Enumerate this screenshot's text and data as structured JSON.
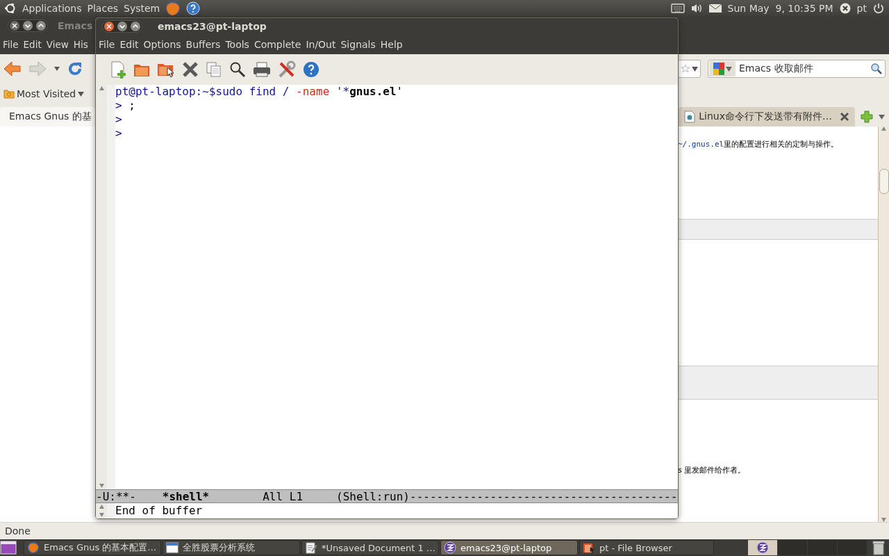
{
  "top_panel": {
    "menus": [
      "Applications",
      "Places",
      "System"
    ],
    "clock": "Sun May  9, 10:35 PM",
    "user": "pt"
  },
  "browser": {
    "title": "Emacs",
    "menus": [
      "File",
      "Edit",
      "View",
      "His"
    ],
    "search": {
      "value": "Emacs 收取邮件"
    },
    "bookmarks": [
      "Most Visited"
    ],
    "tabs": [
      {
        "label": "Emacs Gnus 的基",
        "selected": true
      },
      {
        "label": "Linux命令行下发送带有附件…",
        "selected": false
      }
    ],
    "content": [
      {
        "kind": "text",
        "code": "~/.gnus.el",
        "text": "里的配置进行相关的定制与操作。"
      },
      {
        "kind": "box"
      },
      {
        "kind": "box"
      },
      {
        "kind": "text",
        "text": "s 里发邮件给作者。"
      }
    ],
    "status": "Done"
  },
  "emacs": {
    "title": "emacs23@pt-laptop",
    "menus": [
      "File",
      "Edit",
      "Options",
      "Buffers",
      "Tools",
      "Complete",
      "In/Out",
      "Signals",
      "Help"
    ],
    "lines": [
      [
        {
          "text": "pt@pt-laptop:~$sudo find / ",
          "kind": "input"
        },
        {
          "text": "-name",
          "kind": "option"
        },
        {
          "text": " '*",
          "kind": "input"
        },
        {
          "text": "gnus.el",
          "kind": "match"
        },
        {
          "text": "'",
          "kind": "text"
        }
      ],
      [
        {
          "text": "> ",
          "kind": "input"
        },
        {
          "text": ";",
          "kind": "text"
        }
      ],
      [
        {
          "text": ">",
          "kind": "input"
        }
      ],
      [
        {
          "text": ">",
          "kind": "input"
        }
      ]
    ],
    "modeline": [
      {
        "text": "-U:**-",
        "bold": false
      },
      {
        "text": "*shell*",
        "bold": true
      },
      {
        "text": "All L1",
        "bold": false
      },
      {
        "text": "(Shell:run)----------------------------------------",
        "bold": false
      }
    ],
    "minibuffer": "End of buffer"
  },
  "taskbar": [
    {
      "label": "Emacs Gnus 的基本配置…",
      "kind": "browser",
      "selected": false
    },
    {
      "label": "全胜股票分析系统",
      "kind": "window",
      "selected": false
    },
    {
      "label": "*Unsaved Document 1 …",
      "kind": "editor",
      "selected": false
    },
    {
      "label": "emacs23@pt-laptop",
      "kind": "emacs",
      "selected": true
    },
    {
      "label": "pt - File Browser",
      "kind": "files",
      "selected": false
    }
  ]
}
